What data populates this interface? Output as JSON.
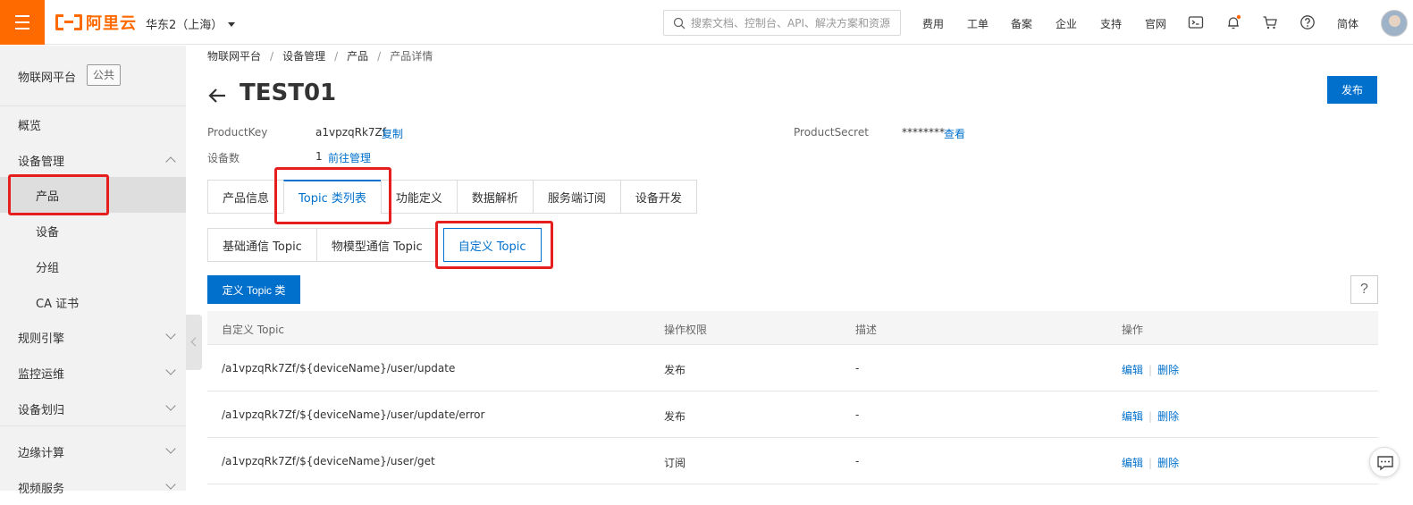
{
  "topbar": {
    "logo_text": "阿里云",
    "region": "华东2（上海）",
    "search_placeholder": "搜索文档、控制台、API、解决方案和资源",
    "links": [
      "费用",
      "工单",
      "备案",
      "企业",
      "支持",
      "官网"
    ],
    "lang": "简体",
    "brand_color": "#ff6a00"
  },
  "sidebar": {
    "platform": "物联网平台",
    "tag": "公共",
    "items": {
      "overview": "概览",
      "device_mgmt": "设备管理",
      "product": "产品",
      "device": "设备",
      "group": "分组",
      "ca": "CA 证书",
      "rules": "规则引擎",
      "monitor": "监控运维",
      "assign": "设备划归",
      "edge": "边缘计算",
      "video": "视频服务"
    }
  },
  "breadcrumb": [
    "物联网平台",
    "设备管理",
    "产品",
    "产品详情"
  ],
  "page": {
    "title": "TEST01",
    "publish": "发布",
    "product_key_label": "ProductKey",
    "product_key": "a1vpzqRk7Zf",
    "copy": "复制",
    "product_secret_label": "ProductSecret",
    "product_secret": "********",
    "view": "查看",
    "device_count_label": "设备数",
    "device_count": "1",
    "go_manage": "前往管理"
  },
  "tabs": [
    "产品信息",
    "Topic 类列表",
    "功能定义",
    "数据解析",
    "服务端订阅",
    "设备开发"
  ],
  "subtabs": [
    "基础通信 Topic",
    "物模型通信 Topic",
    "自定义 Topic"
  ],
  "actions": {
    "define": "定义 Topic 类",
    "help": "?"
  },
  "table": {
    "headers": [
      "自定义 Topic",
      "操作权限",
      "描述",
      "操作"
    ],
    "rows": [
      {
        "topic": "/a1vpzqRk7Zf/${deviceName}/user/update",
        "perm": "发布",
        "desc": "-",
        "edit": "编辑",
        "del": "删除"
      },
      {
        "topic": "/a1vpzqRk7Zf/${deviceName}/user/update/error",
        "perm": "发布",
        "desc": "-",
        "edit": "编辑",
        "del": "删除"
      },
      {
        "topic": "/a1vpzqRk7Zf/${deviceName}/user/get",
        "perm": "订阅",
        "desc": "-",
        "edit": "编辑",
        "del": "删除"
      }
    ]
  },
  "accent_color": "#0070cc"
}
